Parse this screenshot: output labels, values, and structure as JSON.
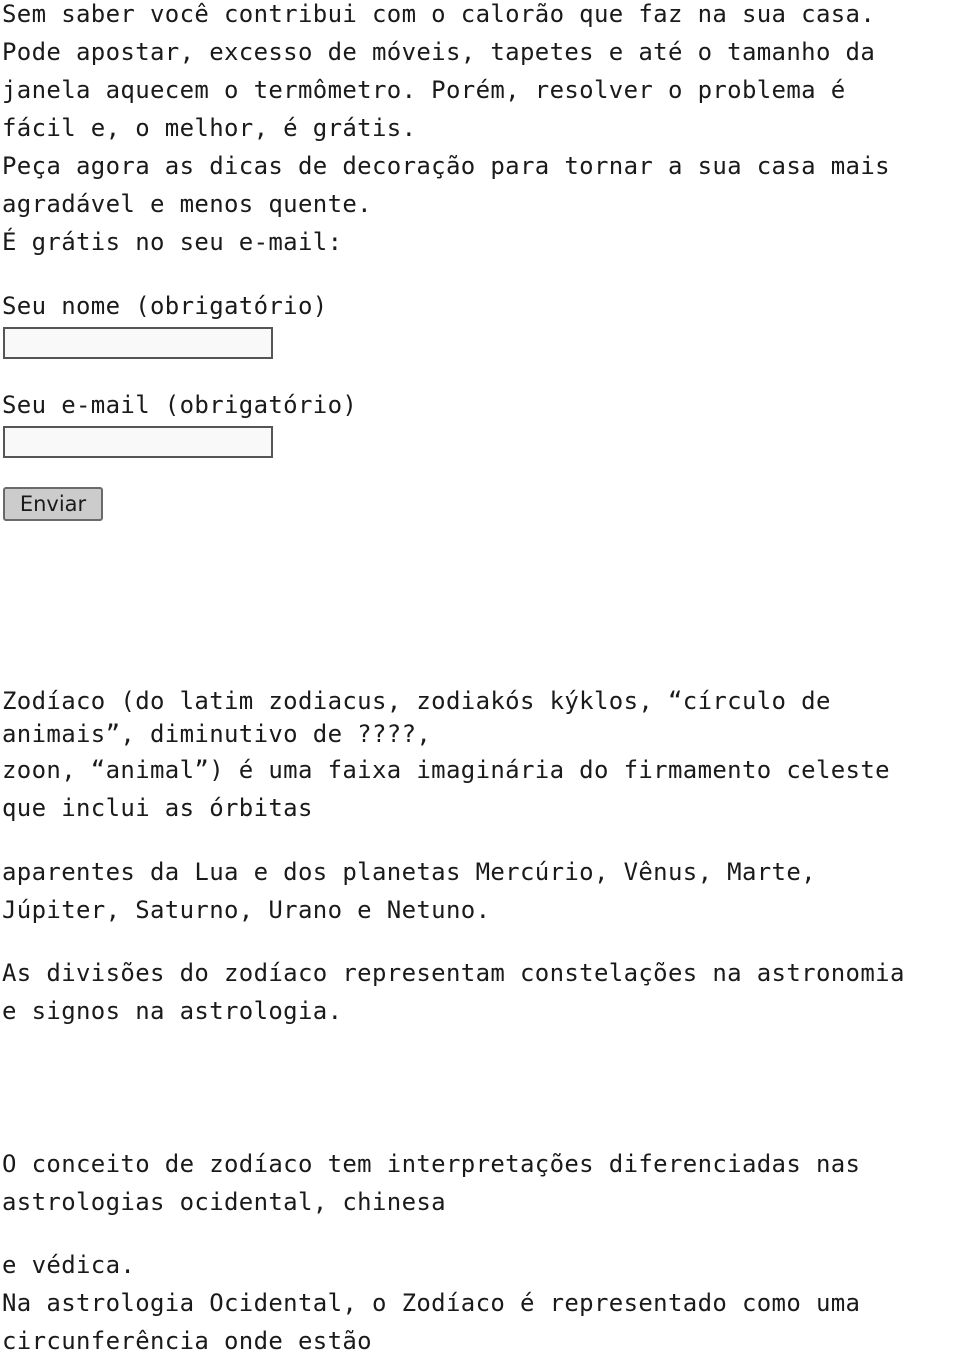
{
  "intro": {
    "lines": [
      "Sem saber você contribui com o calorão que faz na sua casa.",
      "Pode apostar, excesso de móveis, tapetes e até o tamanho da",
      "janela aquecem o termômetro. Porém, resolver o problema é",
      "fácil e, o melhor, é grátis.",
      "Peça agora as dicas de decoração para tornar a sua casa mais",
      "agradável e menos quente.",
      "É grátis no seu e-mail:"
    ]
  },
  "form": {
    "name_label": "Seu nome (obrigatório)",
    "name_value": "",
    "email_label": "Seu e-mail (obrigatório)",
    "email_value": "",
    "submit_label": "Enviar"
  },
  "article": {
    "paragraph1": [
      "Zodíaco (do latim zodiacus, zodiakós kýklos, “círculo de",
      "animais”, diminutivo de ????,",
      "zoon, “animal”) é uma faixa imaginária do firmamento celeste",
      "que inclui as órbitas"
    ],
    "paragraph2": [
      "aparentes da Lua e dos planetas Mercúrio, Vênus, Marte,",
      "Júpiter, Saturno, Urano e Netuno."
    ],
    "paragraph3": [
      "As divisões do zodíaco representam constelações na astronomia",
      "e signos na astrologia."
    ],
    "paragraph4": [
      "O conceito de zodíaco tem interpretações diferenciadas nas",
      "astrologias ocidental, chinesa"
    ],
    "paragraph5": [
      "e védica.",
      "Na astrologia Ocidental, o Zodíaco é representado como uma",
      "circunferência onde estão"
    ]
  }
}
